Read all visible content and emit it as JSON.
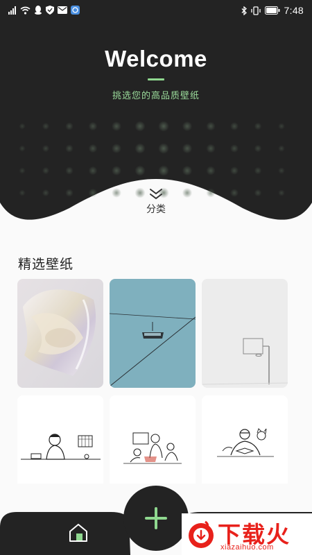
{
  "status_bar": {
    "time": "7:48",
    "left_icons": [
      "signal-icon",
      "wifi-icon",
      "qq-icon",
      "shield-icon",
      "mail-icon",
      "app-icon"
    ],
    "right_icons": [
      "bluetooth-icon",
      "vibrate-icon",
      "battery-icon"
    ]
  },
  "hero": {
    "title": "Welcome",
    "subtitle": "挑选您的高品质壁纸",
    "category_label": "分类"
  },
  "featured": {
    "title": "精选壁纸",
    "tiles": [
      {
        "name": "abstract-glass-wallpaper"
      },
      {
        "name": "cable-car-wallpaper"
      },
      {
        "name": "basketball-hoop-wallpaper"
      },
      {
        "name": "person-drawing-wallpaper"
      },
      {
        "name": "family-sketch-wallpaper"
      },
      {
        "name": "reading-sketch-wallpaper"
      }
    ]
  },
  "bottom_nav": {
    "home_icon": "home-icon",
    "add_icon": "plus-icon"
  },
  "watermark": {
    "title": "下载火",
    "subtitle": "xiazaihuo.com"
  },
  "colors": {
    "dark": "#232323",
    "accent": "#8fd88f",
    "background": "#fafafa",
    "watermark_red": "#e8211b"
  }
}
